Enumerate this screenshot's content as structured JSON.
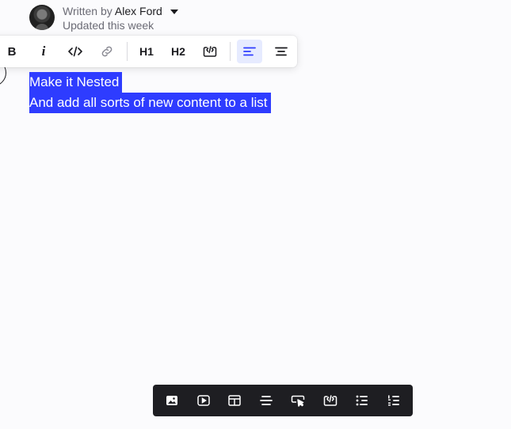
{
  "header": {
    "written_by": "Written by",
    "author_name": "Alex Ford",
    "updated": "Updated this week"
  },
  "format_toolbar": {
    "bold_label": "B",
    "italic_label": "i",
    "h1_label": "H1",
    "h2_label": "H2",
    "icons": [
      "code-icon",
      "link-icon",
      "embed-icon",
      "align-left-icon",
      "align-center-icon"
    ],
    "active": "align-left"
  },
  "editor": {
    "lines": [
      "Make it Nested",
      "And add all sorts of new content to a list"
    ],
    "selection_color": "#2e3cff"
  },
  "insert_toolbar": {
    "icons": [
      "image-icon",
      "video-icon",
      "table-icon",
      "divider-icon",
      "button-icon",
      "embed-icon",
      "bullet-list-icon",
      "numbered-list-icon"
    ]
  }
}
